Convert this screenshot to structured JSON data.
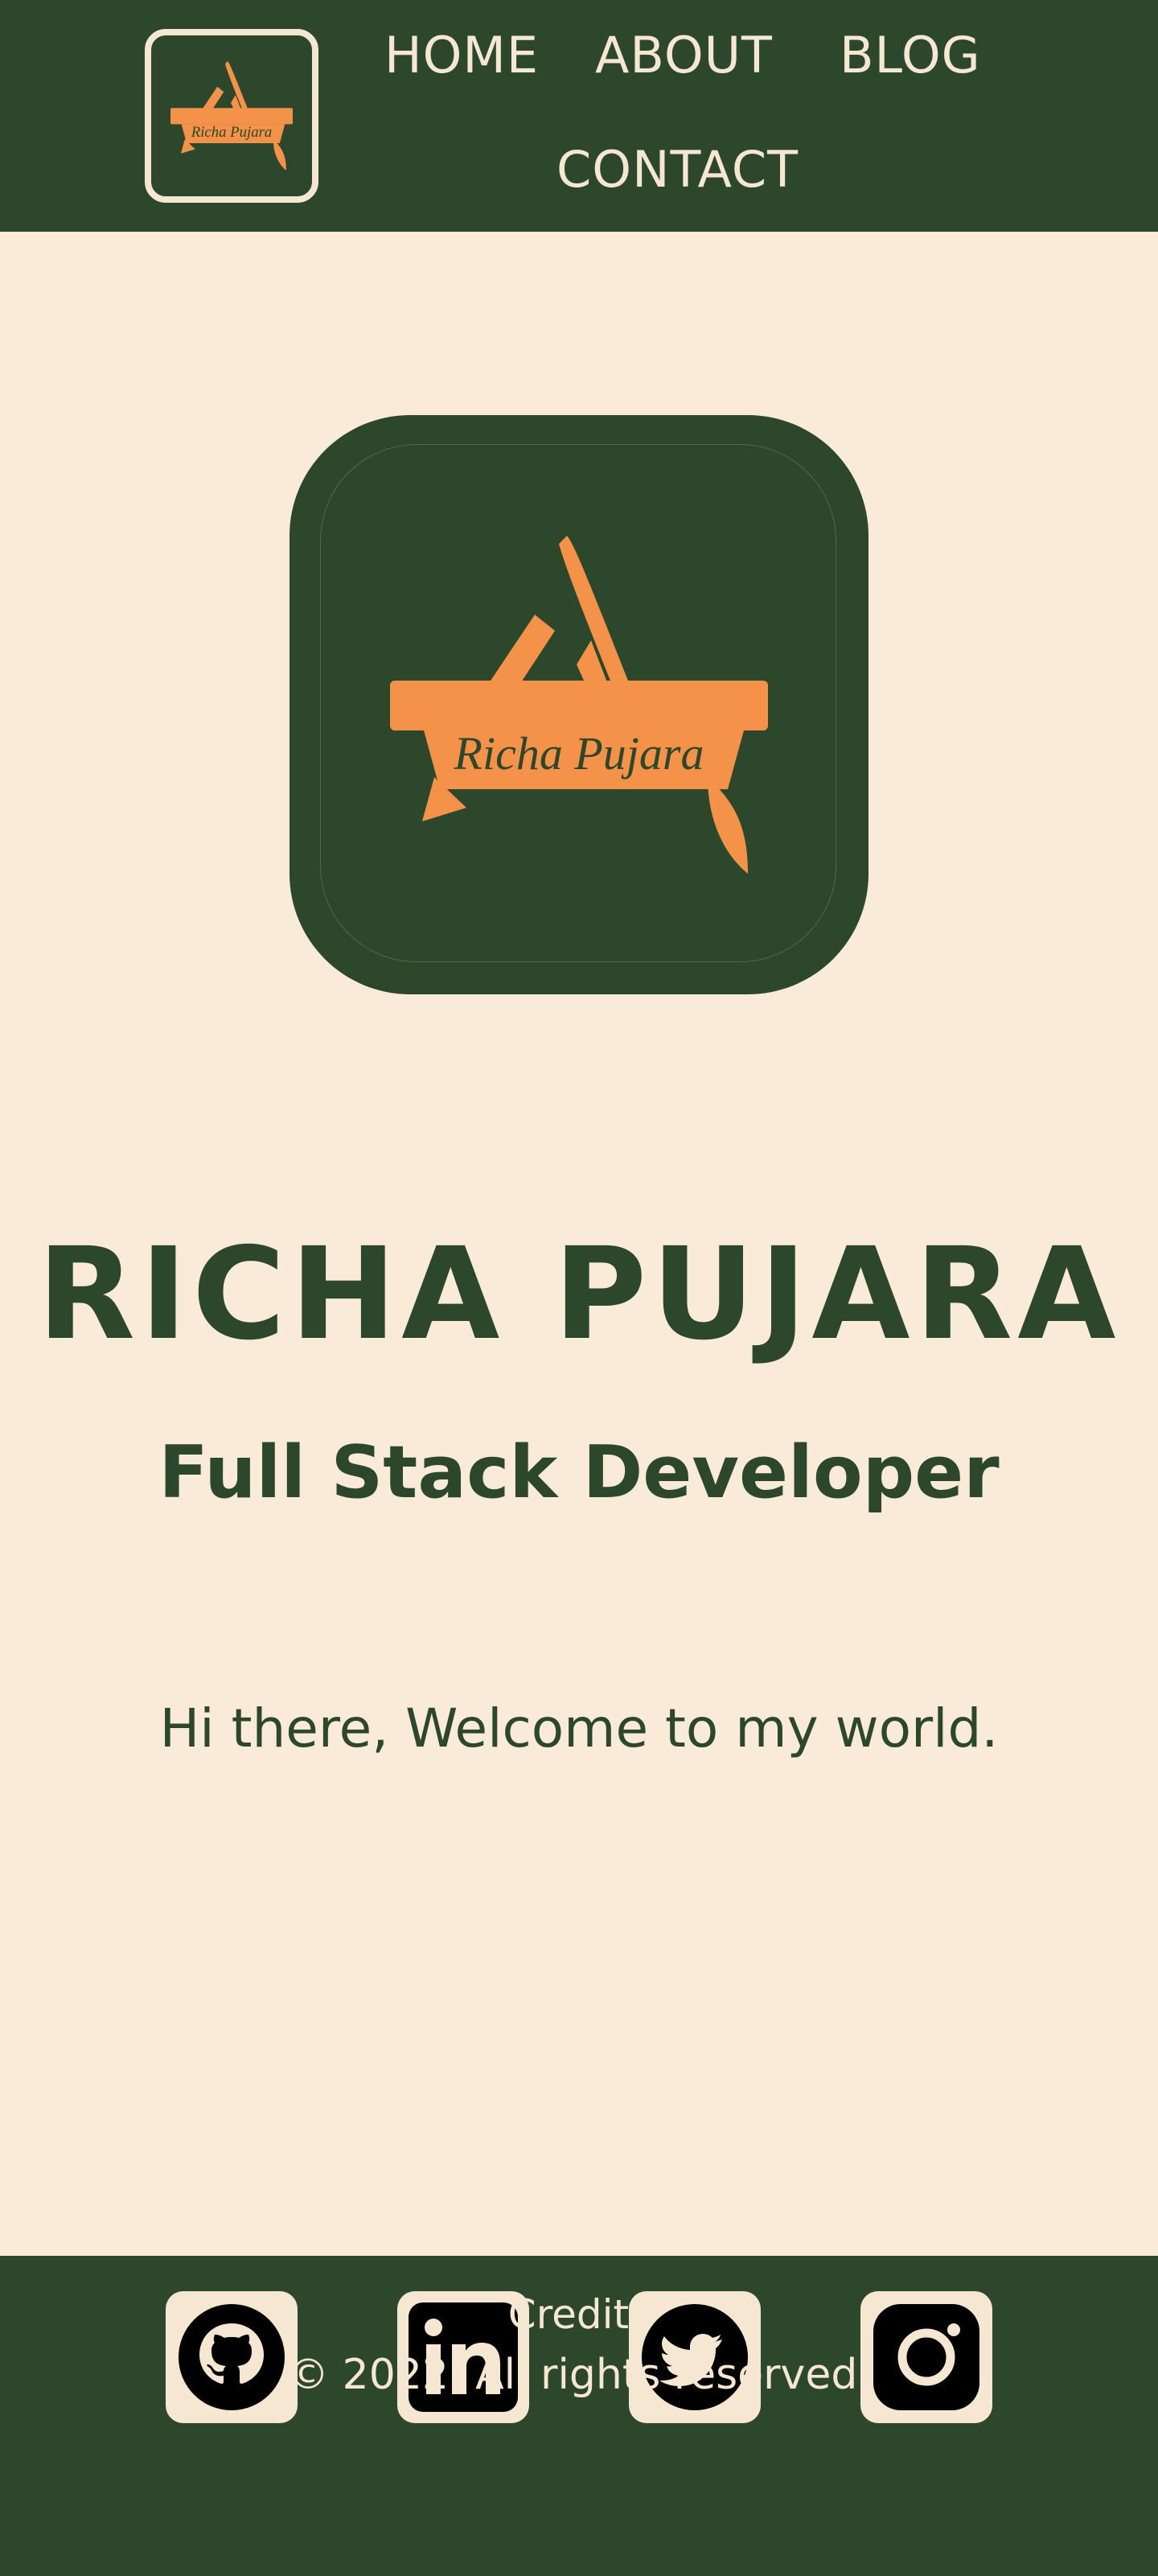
{
  "colors": {
    "primary_green": "#2c472c",
    "cream": "#f9ebd8",
    "accent_orange": "#f4924a"
  },
  "nav": {
    "items": [
      {
        "label": "HOME"
      },
      {
        "label": "ABOUT"
      },
      {
        "label": "BLOG"
      },
      {
        "label": "CONTACT"
      }
    ]
  },
  "logo": {
    "text": "Richa Pujara",
    "icon": "easel-paintbrush-logo"
  },
  "hero": {
    "name": "RICHA PUJARA",
    "role": "Full Stack Developer",
    "welcome": "Hi there, Welcome to my world."
  },
  "footer": {
    "social": [
      {
        "icon": "github-icon"
      },
      {
        "icon": "linkedin-icon"
      },
      {
        "icon": "twitter-icon"
      },
      {
        "icon": "instagram-icon"
      }
    ],
    "credits": "Credits",
    "copyright": "© 2022. All rights reserved."
  }
}
